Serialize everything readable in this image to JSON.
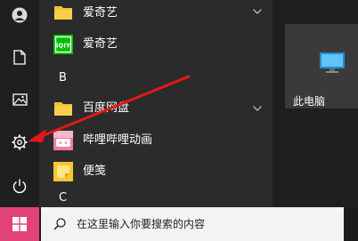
{
  "rail": {
    "buttons": [
      {
        "name": "user-icon"
      },
      {
        "name": "document-icon"
      },
      {
        "name": "pictures-icon"
      },
      {
        "name": "settings-gear-icon"
      },
      {
        "name": "power-icon"
      }
    ]
  },
  "menu": {
    "items": [
      {
        "type": "folder",
        "label": "爱奇艺",
        "icon": "folder-icon",
        "expandable": true
      },
      {
        "type": "app",
        "label": "爱奇艺",
        "icon": "iqiyi-app-icon"
      },
      {
        "type": "header",
        "label": "B"
      },
      {
        "type": "folder",
        "label": "百度网盘",
        "icon": "folder-icon",
        "expandable": true
      },
      {
        "type": "app",
        "label": "哔哩哔哩动画",
        "icon": "bilibili-app-icon"
      },
      {
        "type": "app",
        "label": "便笺",
        "icon": "sticky-notes-icon"
      },
      {
        "type": "header",
        "label": "C"
      }
    ]
  },
  "tiles": {
    "this_pc_label": "此电脑"
  },
  "taskbar": {
    "search_placeholder": "在这里输入你要搜索的内容"
  },
  "colors": {
    "start_button": "#e1427a",
    "folder": "#f2c12e",
    "iqiyi": "#00be06",
    "annotation_arrow": "#e11919"
  }
}
